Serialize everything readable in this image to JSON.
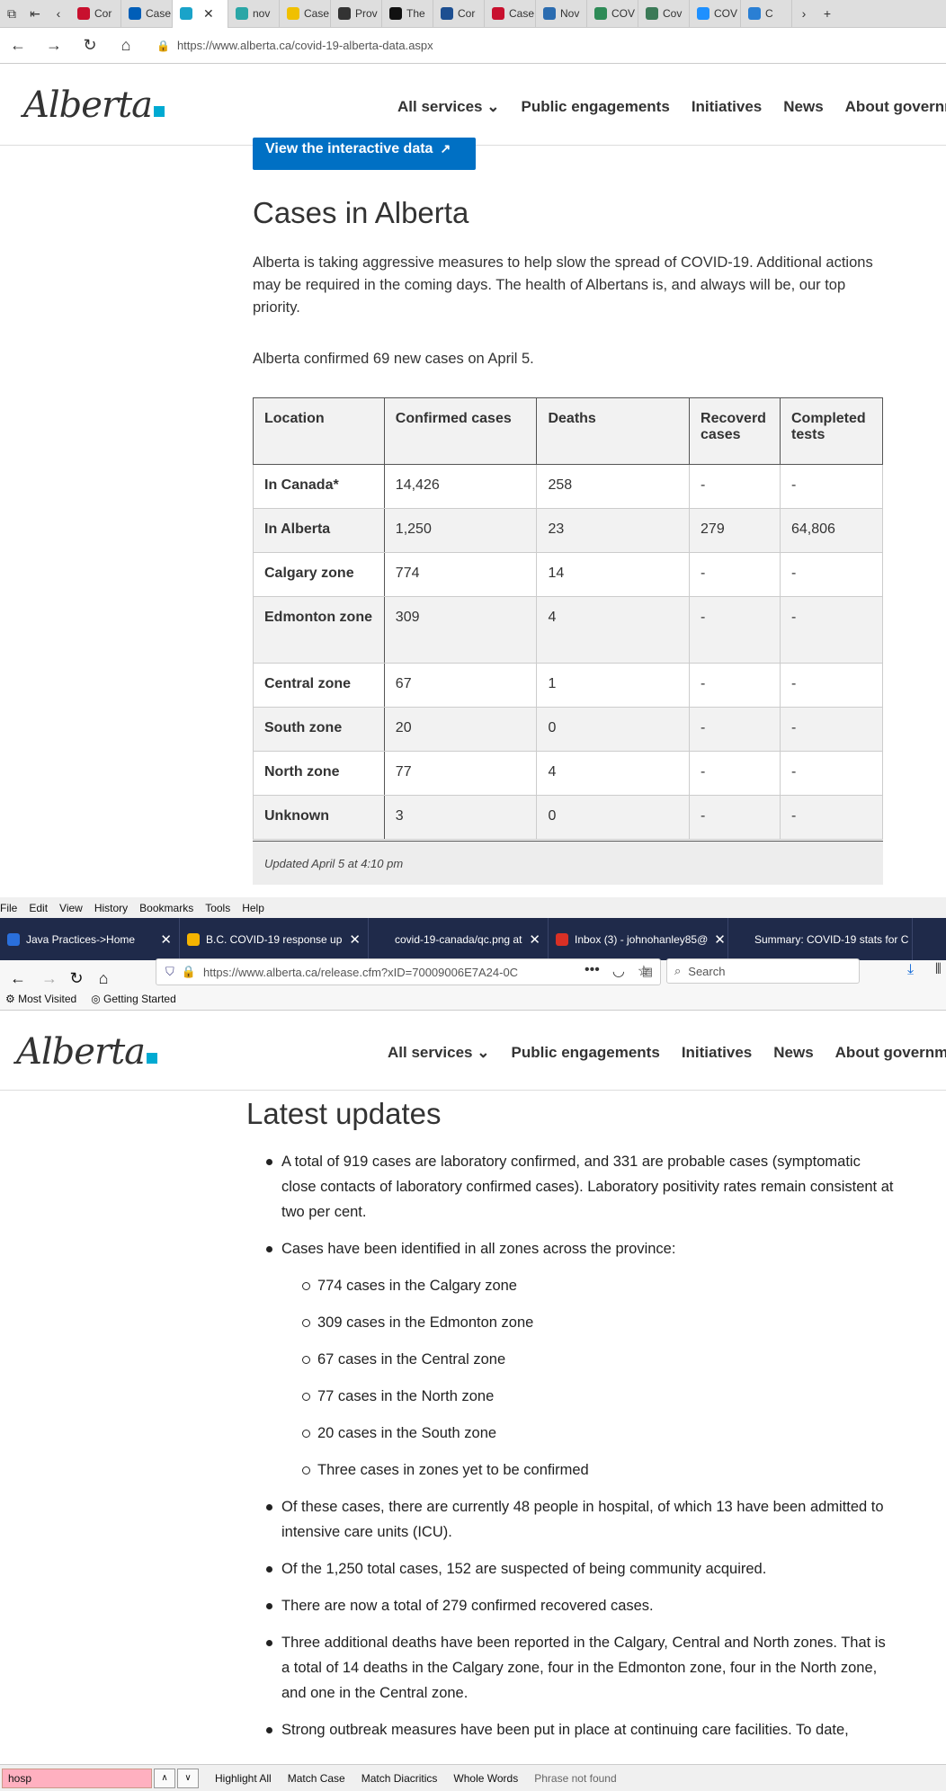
{
  "browser1": {
    "tabs": [
      "Cor",
      "Case",
      "",
      "nov",
      "Case",
      "Prov",
      "The",
      "Cor",
      "Case",
      "Nov",
      "COV",
      "Cov",
      "COV",
      "C"
    ],
    "active_tab_index": 2,
    "url": "https://www.alberta.ca/covid-19-alberta-data.aspx"
  },
  "site": {
    "logo_text": "Alberta",
    "nav": [
      "All services",
      "Public engagements",
      "Initiatives",
      "News",
      "About governm"
    ]
  },
  "page1": {
    "interactive_button": "View the interactive data",
    "heading": "Cases in Alberta",
    "intro": "Alberta is taking aggressive measures to help slow the spread of COVID-19. Additional actions may be required in the coming days. The health of Albertans is, and always will be, our top priority.",
    "confirmed_note": "Alberta confirmed 69 new cases on April 5.",
    "table": {
      "headers": [
        "Location",
        "Confirmed cases",
        "Deaths",
        "Recoverd cases",
        "Completed tests"
      ],
      "rows": [
        [
          "In Canada*",
          "14,426",
          "258",
          "-",
          "-"
        ],
        [
          "In Alberta",
          "1,250",
          "23",
          "279",
          "64,806"
        ],
        [
          "Calgary zone",
          "774",
          "14",
          "-",
          "-"
        ],
        [
          "Edmonton zone",
          "309",
          "4",
          "-",
          "-"
        ],
        [
          "Central zone",
          "67",
          "1",
          "-",
          "-"
        ],
        [
          "South zone",
          "20",
          "0",
          "-",
          "-"
        ],
        [
          "North zone",
          "77",
          "4",
          "-",
          "-"
        ],
        [
          "Unknown",
          "3",
          "0",
          "-",
          "-"
        ]
      ],
      "updated": "Updated April 5 at 4:10 pm"
    }
  },
  "browser2": {
    "menu": [
      "File",
      "Edit",
      "View",
      "History",
      "Bookmarks",
      "Tools",
      "Help"
    ],
    "tabs": [
      "Java Practices->Home",
      "B.C. COVID-19 response up",
      "covid-19-canada/qc.png at",
      "Inbox (3) - johnohanley85@",
      "Summary: COVID-19 stats for C"
    ],
    "url": "https://www.alberta.ca/release.cfm?xID=70009006E7A24-0C",
    "search_placeholder": "Search",
    "bookmarks": [
      "Most Visited",
      "Getting Started"
    ]
  },
  "page2": {
    "heading": "Latest updates",
    "items": [
      "A total of 919 cases are laboratory confirmed, and 331 are probable cases (symptomatic close contacts of laboratory confirmed cases). Laboratory positivity rates remain consistent at two per cent.",
      "Cases have been identified in all zones across the province:",
      "Of these cases, there are currently 48 people in hospital, of which 13 have been admitted to intensive care units (ICU).",
      "Of the 1,250 total cases, 152 are suspected of being community acquired.",
      "There are now a total of 279 confirmed recovered cases.",
      "Three additional deaths have been reported in the Calgary, Central and North zones. That is a total of 14 deaths in the Calgary zone, four in the Edmonton zone, four in the North zone, and one in the Central zone.",
      "Strong outbreak measures have been put in place at continuing care facilities. To date,"
    ],
    "zones": [
      "774 cases in the Calgary zone",
      "309 cases in the Edmonton zone",
      "67 cases in the Central zone",
      "77 cases in the North zone",
      "20 cases in the South zone",
      "Three cases in zones yet to be confirmed"
    ]
  },
  "findbar": {
    "value": "hosp",
    "options": [
      "Highlight All",
      "Match Case",
      "Match Diacritics",
      "Whole Words"
    ],
    "status": "Phrase not found"
  },
  "colors": {
    "accent": "#0070c4",
    "logo_square": "#00aad2",
    "firefox_tabbar": "#1f2a4a",
    "find_error": "#ffb0c0"
  }
}
